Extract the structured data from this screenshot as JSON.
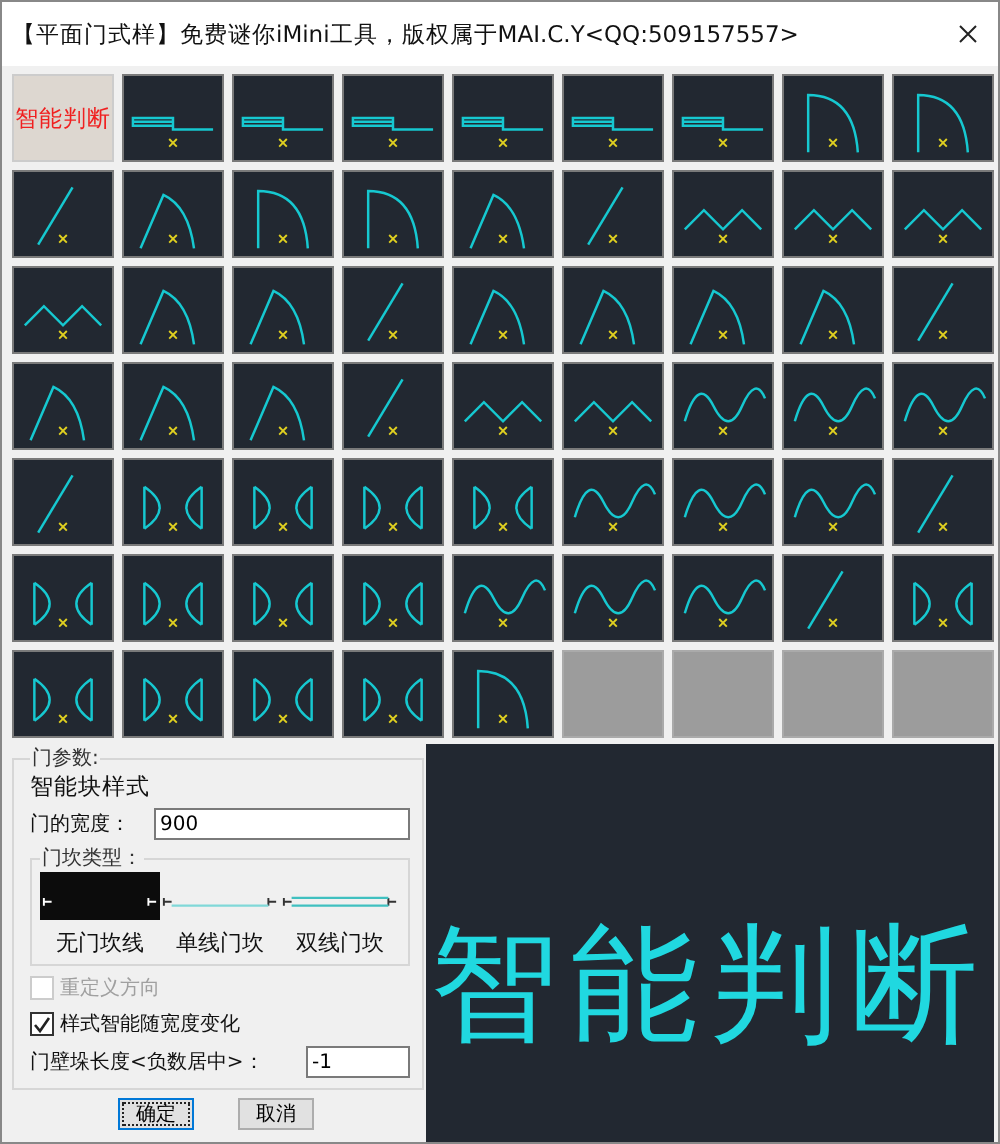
{
  "window": {
    "title": "【平面门式样】免费谜你iMini工具，版权属于MAI.C.Y<QQ:509157557>"
  },
  "thumbnails": [
    {
      "kind": "label",
      "text": "智能判断"
    },
    {
      "kind": "slide"
    },
    {
      "kind": "slide"
    },
    {
      "kind": "slide"
    },
    {
      "kind": "slide"
    },
    {
      "kind": "slide"
    },
    {
      "kind": "slide"
    },
    {
      "kind": "swing"
    },
    {
      "kind": "swing"
    },
    {
      "kind": "line"
    },
    {
      "kind": "arch"
    },
    {
      "kind": "swing"
    },
    {
      "kind": "swing"
    },
    {
      "kind": "arch"
    },
    {
      "kind": "line"
    },
    {
      "kind": "zigzag"
    },
    {
      "kind": "zigzag"
    },
    {
      "kind": "zigzag"
    },
    {
      "kind": "zigzag"
    },
    {
      "kind": "arch"
    },
    {
      "kind": "arch"
    },
    {
      "kind": "line"
    },
    {
      "kind": "arch"
    },
    {
      "kind": "arch"
    },
    {
      "kind": "arch"
    },
    {
      "kind": "arch"
    },
    {
      "kind": "line"
    },
    {
      "kind": "arch"
    },
    {
      "kind": "arch"
    },
    {
      "kind": "arch"
    },
    {
      "kind": "line"
    },
    {
      "kind": "zigzag"
    },
    {
      "kind": "zigzag"
    },
    {
      "kind": "wave"
    },
    {
      "kind": "wave"
    },
    {
      "kind": "wave"
    },
    {
      "kind": "line"
    },
    {
      "kind": "bracket"
    },
    {
      "kind": "bracket"
    },
    {
      "kind": "bracket"
    },
    {
      "kind": "bracket"
    },
    {
      "kind": "wave"
    },
    {
      "kind": "wave"
    },
    {
      "kind": "wave"
    },
    {
      "kind": "line"
    },
    {
      "kind": "bracket"
    },
    {
      "kind": "bracket"
    },
    {
      "kind": "bracket"
    },
    {
      "kind": "bracket"
    },
    {
      "kind": "wave"
    },
    {
      "kind": "wave"
    },
    {
      "kind": "wave"
    },
    {
      "kind": "line"
    },
    {
      "kind": "bracket"
    },
    {
      "kind": "bracket"
    },
    {
      "kind": "bracket"
    },
    {
      "kind": "bracket"
    },
    {
      "kind": "bracket"
    },
    {
      "kind": "swing"
    },
    {
      "kind": "empty"
    },
    {
      "kind": "empty"
    },
    {
      "kind": "empty"
    },
    {
      "kind": "empty"
    }
  ],
  "params": {
    "group_title": "门参数:",
    "style_name": "智能块样式",
    "width_label": "门的宽度：",
    "width_value": "900",
    "sill_group_title": "门坎类型：",
    "sill_options": [
      {
        "label": "无门坎线",
        "kind": "none",
        "selected": true
      },
      {
        "label": "单线门坎",
        "kind": "single",
        "selected": false
      },
      {
        "label": "双线门坎",
        "kind": "double",
        "selected": false
      }
    ],
    "checkboxes": [
      {
        "label": "重定义方向",
        "checked": false,
        "disabled": true
      },
      {
        "label": "样式智能随宽度变化",
        "checked": true,
        "disabled": false
      }
    ],
    "jamb_label": "门壁垛长度<负数居中>：",
    "jamb_value": "-1"
  },
  "buttons": [
    {
      "label": "确定",
      "default": true
    },
    {
      "label": "取消",
      "default": false
    }
  ],
  "preview": {
    "text": "智能判断"
  }
}
